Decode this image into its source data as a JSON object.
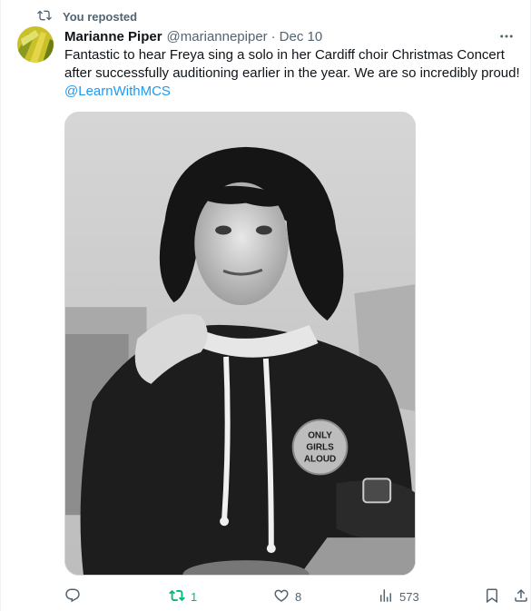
{
  "repost_banner": {
    "icon": "repost-icon",
    "label": "You reposted"
  },
  "tweet": {
    "author_name": "Marianne Piper",
    "author_handle": "@mariannepiper",
    "separator": "·",
    "date": "Dec 10",
    "text": "Fantastic to hear Freya sing a solo in her Cardiff choir Christmas Concert after successfully auditioning earlier in the year. We are so incredibly proud!",
    "mention": "@LearnWithMCS",
    "badge_text": [
      "ONLY",
      "GIRLS",
      "ALOUD"
    ]
  },
  "actions": {
    "reply": {
      "icon": "reply-icon",
      "count": ""
    },
    "repost": {
      "icon": "repost-icon",
      "count": "1"
    },
    "like": {
      "icon": "heart-icon",
      "count": "8"
    },
    "views": {
      "icon": "views-icon",
      "count": "573"
    },
    "bookmark": {
      "icon": "bookmark-icon"
    },
    "share": {
      "icon": "share-icon"
    }
  },
  "colors": {
    "text": "#0f1419",
    "secondary": "#536471",
    "link": "#1d9bf0",
    "repost_active": "#00ba7c"
  }
}
